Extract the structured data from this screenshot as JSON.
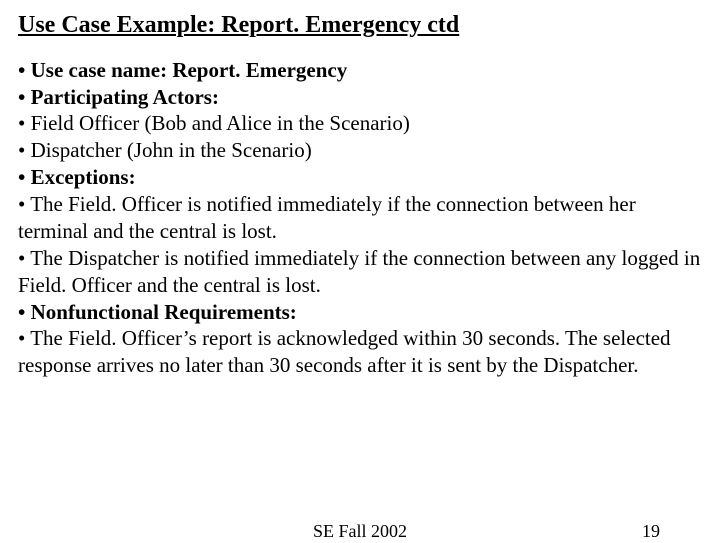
{
  "title": "Use Case Example: Report. Emergency ctd",
  "lines": {
    "l1a": "• Use case name: ",
    "l1b": "Report. Emergency",
    "l2": "• Participating Actors:",
    "l3": "• Field Officer (Bob and Alice in the Scenario)",
    "l4": "• Dispatcher (John in the Scenario)",
    "l5": "• Exceptions:",
    "l6": "• The Field. Officer is notified immediately if the connection between her terminal and the central is lost.",
    "l7": "• The Dispatcher is notified immediately if the connection between any logged in Field. Officer and the central is lost.",
    "l8": "• Nonfunctional Requirements:",
    "l9": "• The Field. Officer’s report is acknowledged within 30 seconds. The selected response arrives no later than 30 seconds after it is sent by the Dispatcher."
  },
  "footer": {
    "center": "SE Fall 2002",
    "page": "19"
  }
}
